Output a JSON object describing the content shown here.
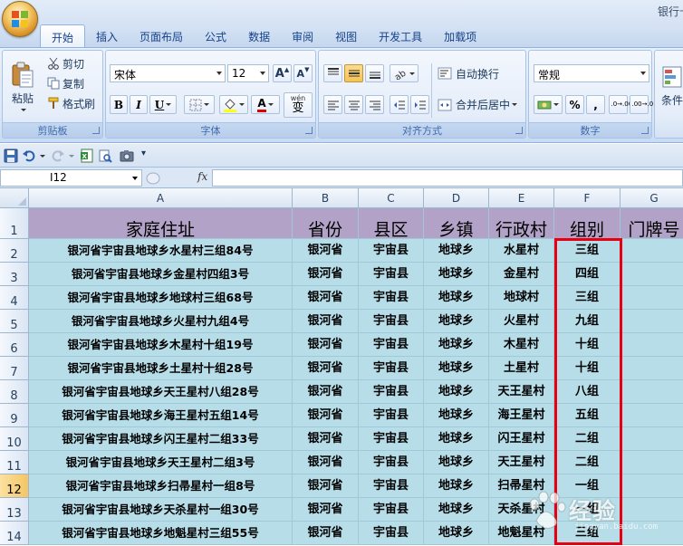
{
  "window": {
    "title": "银行卡"
  },
  "tabs": [
    {
      "label": "开始",
      "active": true
    },
    {
      "label": "插入"
    },
    {
      "label": "页面布局"
    },
    {
      "label": "公式"
    },
    {
      "label": "数据"
    },
    {
      "label": "审阅"
    },
    {
      "label": "视图"
    },
    {
      "label": "开发工具"
    },
    {
      "label": "加载项"
    }
  ],
  "ribbon": {
    "clipboard": {
      "label": "剪贴板",
      "paste": "粘贴",
      "cut": "剪切",
      "copy": "复制",
      "format_painter": "格式刷"
    },
    "font": {
      "label": "字体",
      "font_name": "宋体",
      "font_size": "12",
      "bold": "B",
      "italic": "I",
      "underline": "U",
      "font_color": "A",
      "wen": "wén",
      "wen_char": "变",
      "grow": "A",
      "shrink": "A"
    },
    "alignment": {
      "label": "对齐方式",
      "wrap_text": "自动换行",
      "merge_center": "合并后居中"
    },
    "number": {
      "label": "数字",
      "format": "常规",
      "percent": "%",
      "comma": ",",
      "inc_decimal": ".0→.00",
      "dec_decimal": ".00→.0"
    },
    "styles": {
      "label": "条件"
    }
  },
  "formula_bar": {
    "name_box": "I12",
    "fx": "fx",
    "formula": ""
  },
  "grid": {
    "columns": [
      "A",
      "B",
      "C",
      "D",
      "E",
      "F",
      "G"
    ],
    "rows": [
      "1",
      "2",
      "3",
      "4",
      "5",
      "6",
      "7",
      "8",
      "9",
      "10",
      "11",
      "12",
      "13",
      "14"
    ],
    "selected_row": "12",
    "header_row": [
      "家庭住址",
      "省份",
      "县区",
      "乡镇",
      "行政村",
      "组别",
      "门牌号"
    ],
    "data_rows": [
      [
        "银河省宇宙县地球乡水星村三组84号",
        "银河省",
        "宇宙县",
        "地球乡",
        "水星村",
        "三组",
        ""
      ],
      [
        "银河省宇宙县地球乡金星村四组3号",
        "银河省",
        "宇宙县",
        "地球乡",
        "金星村",
        "四组",
        ""
      ],
      [
        "银河省宇宙县地球乡地球村三组68号",
        "银河省",
        "宇宙县",
        "地球乡",
        "地球村",
        "三组",
        ""
      ],
      [
        "银河省宇宙县地球乡火星村九组4号",
        "银河省",
        "宇宙县",
        "地球乡",
        "火星村",
        "九组",
        ""
      ],
      [
        "银河省宇宙县地球乡木星村十组19号",
        "银河省",
        "宇宙县",
        "地球乡",
        "木星村",
        "十组",
        ""
      ],
      [
        "银河省宇宙县地球乡土星村十组28号",
        "银河省",
        "宇宙县",
        "地球乡",
        "土星村",
        "十组",
        ""
      ],
      [
        "银河省宇宙县地球乡天王星村八组28号",
        "银河省",
        "宇宙县",
        "地球乡",
        "天王星村",
        "八组",
        ""
      ],
      [
        "银河省宇宙县地球乡海王星村五组14号",
        "银河省",
        "宇宙县",
        "地球乡",
        "海王星村",
        "五组",
        ""
      ],
      [
        "银河省宇宙县地球乡闪王星村二组33号",
        "银河省",
        "宇宙县",
        "地球乡",
        "闪王星村",
        "二组",
        ""
      ],
      [
        "银河省宇宙县地球乡天王星村二组3号",
        "银河省",
        "宇宙县",
        "地球乡",
        "天王星村",
        "二组",
        ""
      ],
      [
        "银河省宇宙县地球乡扫帚星村一组8号",
        "银河省",
        "宇宙县",
        "地球乡",
        "扫帚星村",
        "一组",
        ""
      ],
      [
        "银河省宇宙县地球乡天杀星村一组30号",
        "银河省",
        "宇宙县",
        "地球乡",
        "天杀星村",
        "一组",
        ""
      ],
      [
        "银河省宇宙县地球乡地魁星村三组55号",
        "银河省",
        "宇宙县",
        "地球乡",
        "地魁星村",
        "三组",
        ""
      ]
    ]
  },
  "watermark": {
    "text": "经验",
    "sub": "jingyan.baidu.com"
  },
  "colors": {
    "header_fill": "#b3a2c7",
    "cell_fill": "#b6dde8",
    "highlight": "#e60012"
  }
}
